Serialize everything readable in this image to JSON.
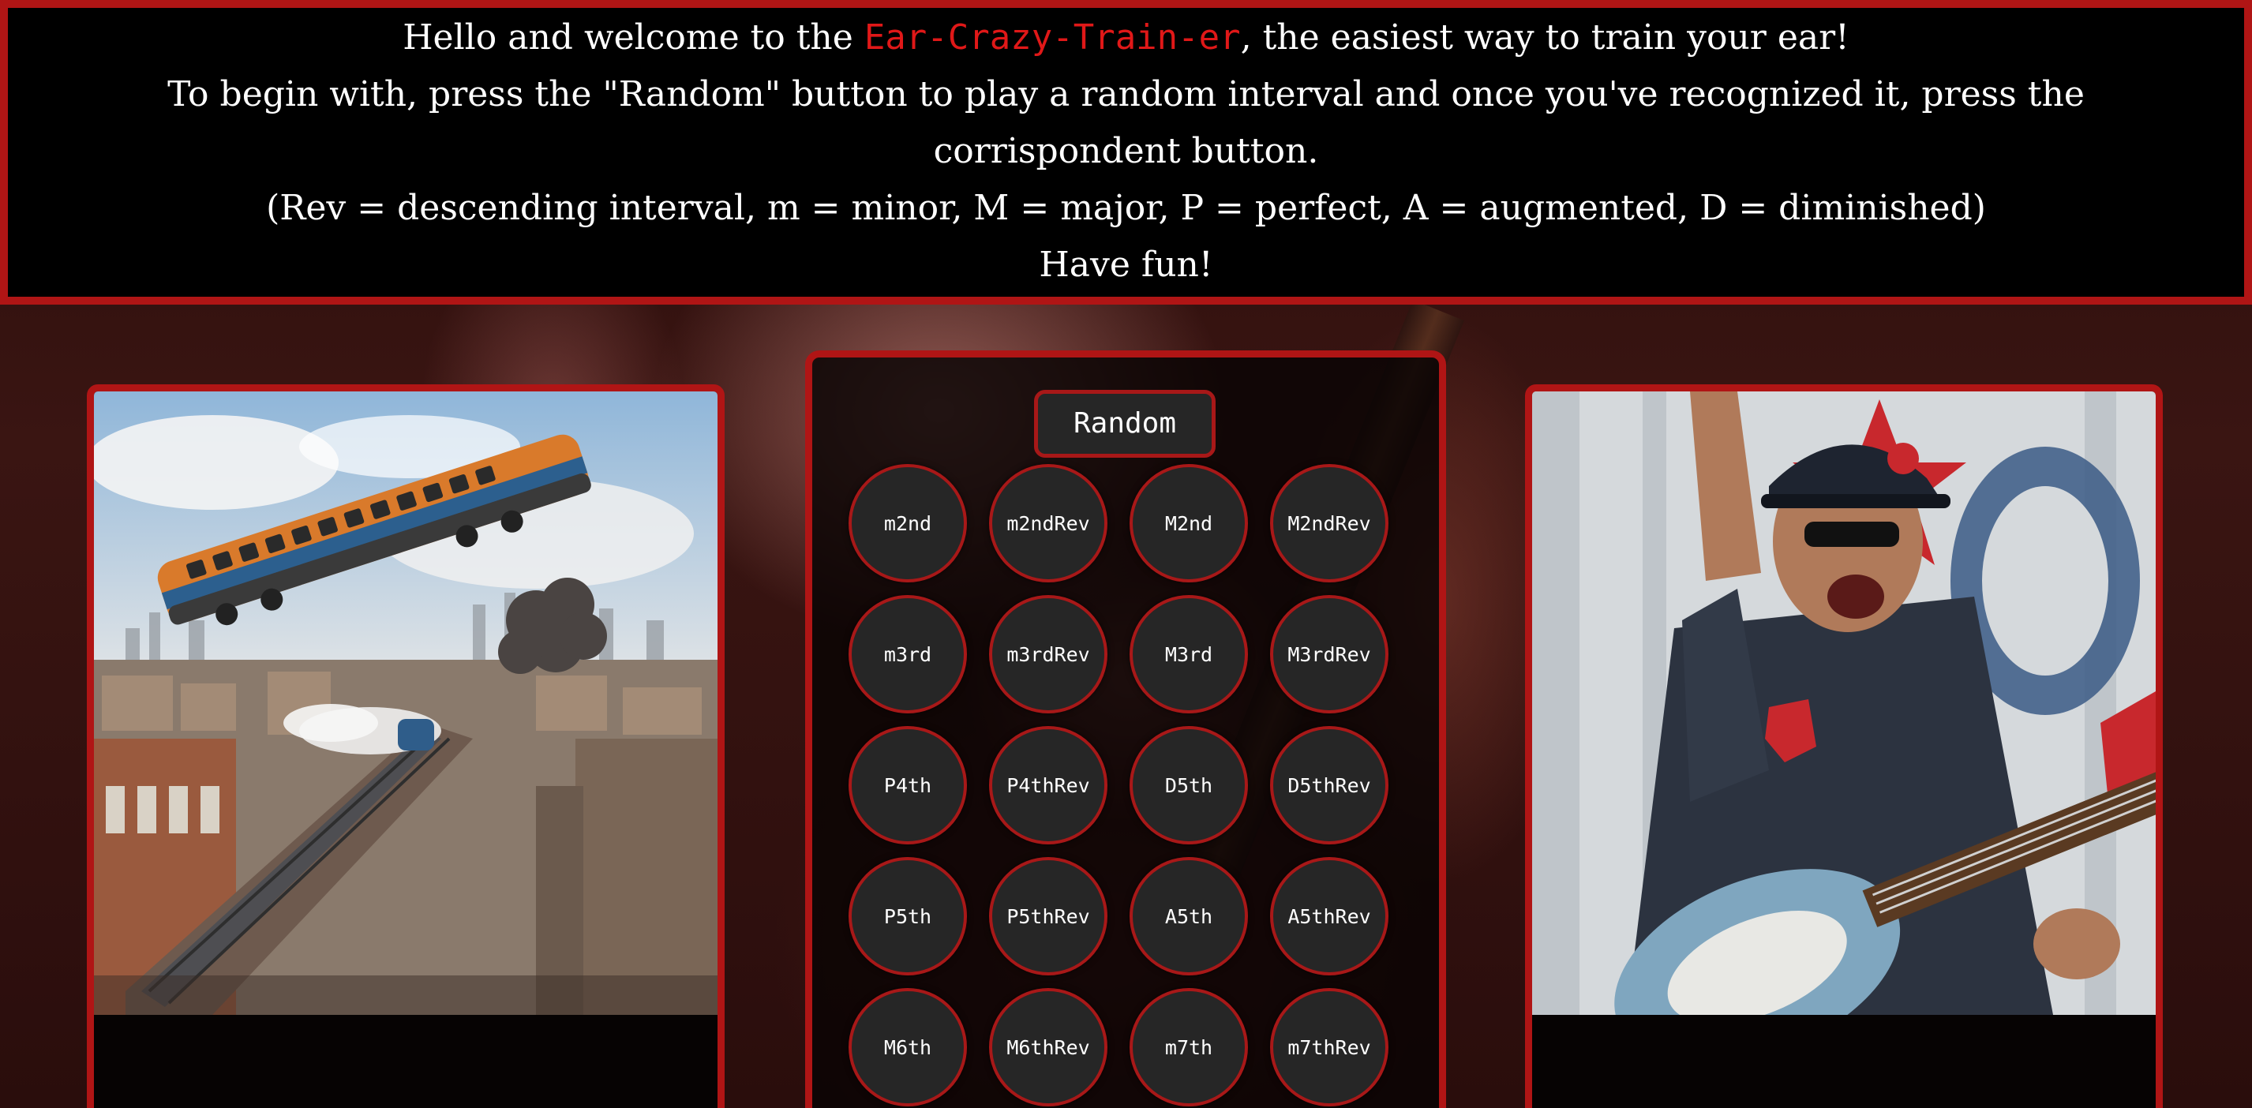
{
  "header": {
    "line1_before": "Hello and welcome to the ",
    "line1_accent": "Ear-Crazy-Train-er",
    "line1_after": ", the easiest way to train your ear!",
    "line2": "To begin with, press the \"Random\" button to play a random interval and once you've recognized it, press the",
    "line3": "corrispondent button.",
    "line4": "(Rev = descending interval, m = minor, M = major, P = perfect, A = augmented, D = diminished)",
    "line5": "Have fun!"
  },
  "controls": {
    "random_label": "Random"
  },
  "intervals": [
    [
      "m2nd",
      "m2ndRev",
      "M2nd",
      "M2ndRev"
    ],
    [
      "m3rd",
      "m3rdRev",
      "M3rd",
      "M3rdRev"
    ],
    [
      "P4th",
      "P4thRev",
      "D5th",
      "D5thRev"
    ],
    [
      "P5th",
      "P5thRev",
      "A5th",
      "A5thRev"
    ],
    [
      "M6th",
      "M6thRev",
      "m7th",
      "m7thRev"
    ]
  ],
  "images": {
    "left": "flying-train-city-image",
    "right": "guitarist-performing-image"
  },
  "colors": {
    "accent": "#e01818",
    "border": "#b01515",
    "button_bg": "#262626",
    "header_bg": "#000000"
  }
}
